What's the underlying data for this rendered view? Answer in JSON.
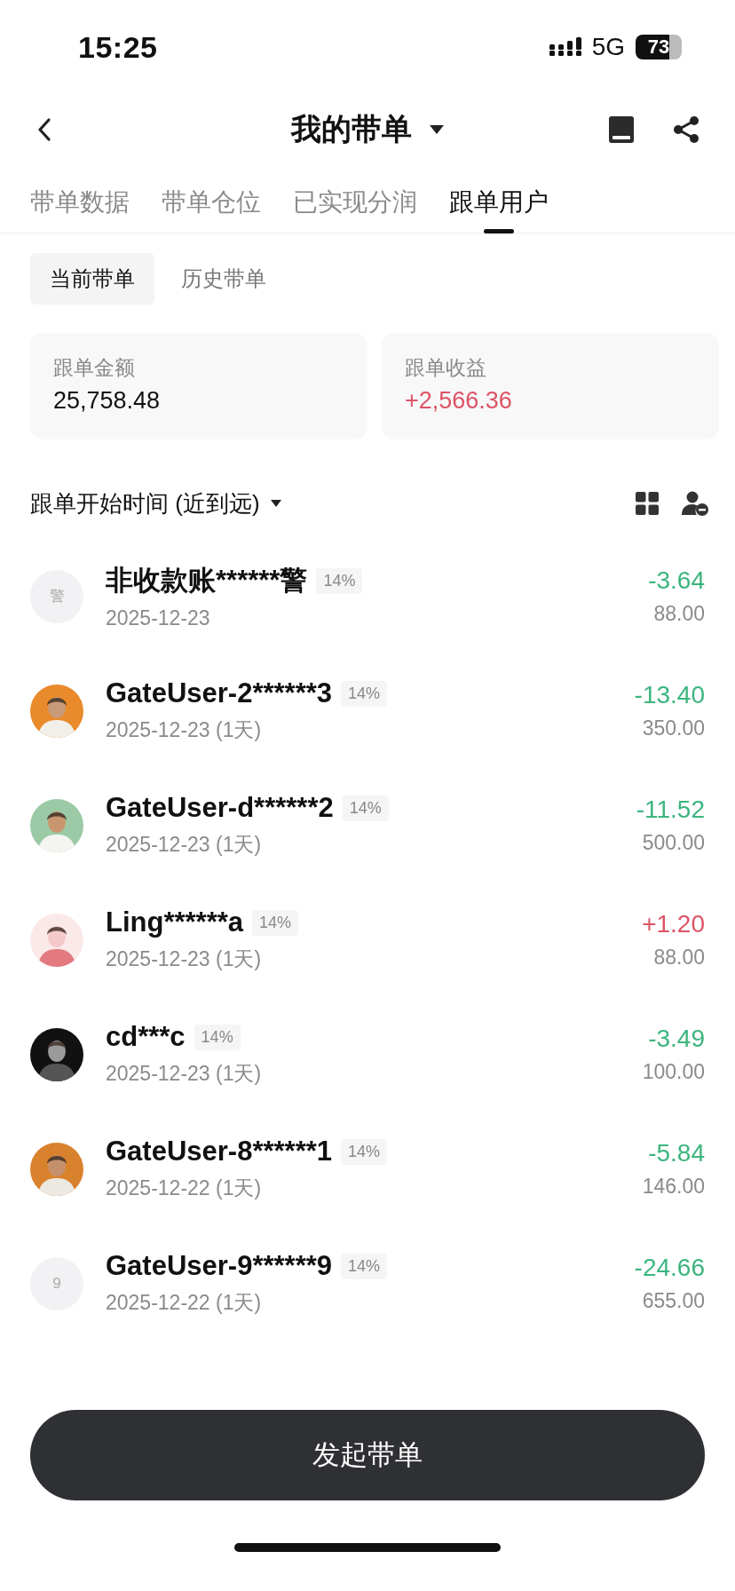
{
  "status_bar": {
    "time": "15:25",
    "network": "5G",
    "battery": "73"
  },
  "header": {
    "title": "我的带单"
  },
  "tabs": [
    {
      "label": "带单数据",
      "selected": false
    },
    {
      "label": "带单仓位",
      "selected": false
    },
    {
      "label": "已实现分润",
      "selected": false
    },
    {
      "label": "跟单用户",
      "selected": true
    }
  ],
  "segments": [
    {
      "label": "当前带单",
      "selected": true
    },
    {
      "label": "历史带单",
      "selected": false
    }
  ],
  "cards": [
    {
      "label": "跟单金额",
      "value": "25,758.48",
      "color": "#111111"
    },
    {
      "label": "跟单收益",
      "value": "+2,566.36",
      "color": "#dd5466"
    }
  ],
  "sort": {
    "label": "跟单开始时间 (近到远)"
  },
  "followers": [
    {
      "avatar": {
        "kind": "letter",
        "text": "警"
      },
      "name": "非收款账******警",
      "share": "14%",
      "date": "2025-12-23",
      "pnl": "-3.64",
      "color": "#3cb57e",
      "amount": "88.00"
    },
    {
      "name": "GateUser-2******3",
      "share": "14%",
      "date": "2025-12-23 (1天)",
      "pnl": "-13.40",
      "color": "#3cb57e",
      "amount": "350.00"
    },
    {
      "name": "GateUser-d******2",
      "share": "14%",
      "date": "2025-12-23 (1天)",
      "pnl": "-11.52",
      "color": "#3cb57e",
      "amount": "500.00"
    },
    {
      "name": "Ling******a",
      "share": "14%",
      "date": "2025-12-23 (1天)",
      "pnl": "+1.20",
      "color": "#dd5466",
      "amount": "88.00"
    },
    {
      "name": "cd***c",
      "share": "14%",
      "date": "2025-12-23 (1天)",
      "pnl": "-3.49",
      "color": "#3cb57e",
      "amount": "100.00"
    },
    {
      "name": "GateUser-8******1",
      "share": "14%",
      "date": "2025-12-22 (1天)",
      "pnl": "-5.84",
      "color": "#3cb57e",
      "amount": "146.00"
    },
    {
      "avatar": {
        "kind": "letter",
        "text": "9"
      },
      "name": "GateUser-9******9",
      "share": "14%",
      "date": "2025-12-22 (1天)",
      "pnl": "-24.66",
      "color": "#3cb57e",
      "amount": "655.00"
    }
  ],
  "primary_button": {
    "label": "发起带单"
  }
}
